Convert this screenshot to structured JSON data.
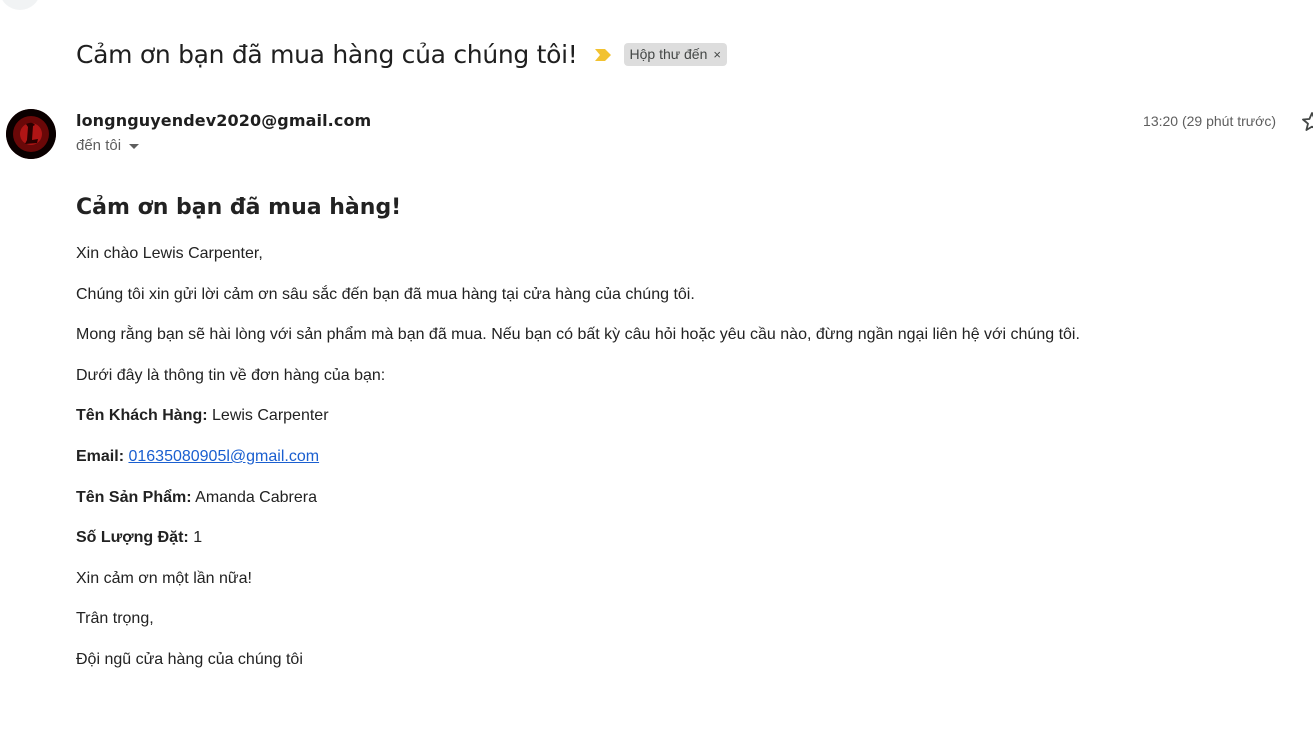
{
  "subject": "Cảm ơn bạn đã mua hàng của chúng tôi!",
  "label": {
    "name": "Hộp thư đến",
    "close_glyph": "×"
  },
  "sender": {
    "email": "longnguyendev2020@gmail.com",
    "recipient_text": "đến tôi"
  },
  "timestamp": "13:20 (29 phút trước)",
  "body": {
    "heading": "Cảm ơn bạn đã mua hàng!",
    "greeting": "Xin chào Lewis Carpenter,",
    "thanks": "Chúng tôi xin gửi lời cảm ơn sâu sắc đến bạn đã mua hàng tại cửa hàng của chúng tôi.",
    "hope": "Mong rằng bạn sẽ hài lòng với sản phẩm mà bạn đã mua. Nếu bạn có bất kỳ câu hỏi hoặc yêu cầu nào, đừng ngần ngại liên hệ với chúng tôi.",
    "order_intro": "Dưới đây là thông tin về đơn hàng của bạn:",
    "customer_name_label": "Tên Khách Hàng:",
    "customer_name_value": "Lewis Carpenter",
    "email_label": "Email:",
    "email_value": "01635080905l@gmail.com",
    "product_label": "Tên Sản Phẩm:",
    "product_value": "Amanda Cabrera",
    "quantity_label": "Số Lượng Đặt:",
    "quantity_value": "1",
    "thanks_again": "Xin cảm ơn một lần nữa!",
    "regards": "Trân trọng,",
    "signature": "Đội ngũ cửa hàng của chúng tôi"
  },
  "icons": {
    "importance": "importance-marker-icon",
    "caret": "chevron-down-icon",
    "star": "star-icon",
    "avatar_color": "#c41a1a",
    "importance_color": "#f2c230"
  }
}
